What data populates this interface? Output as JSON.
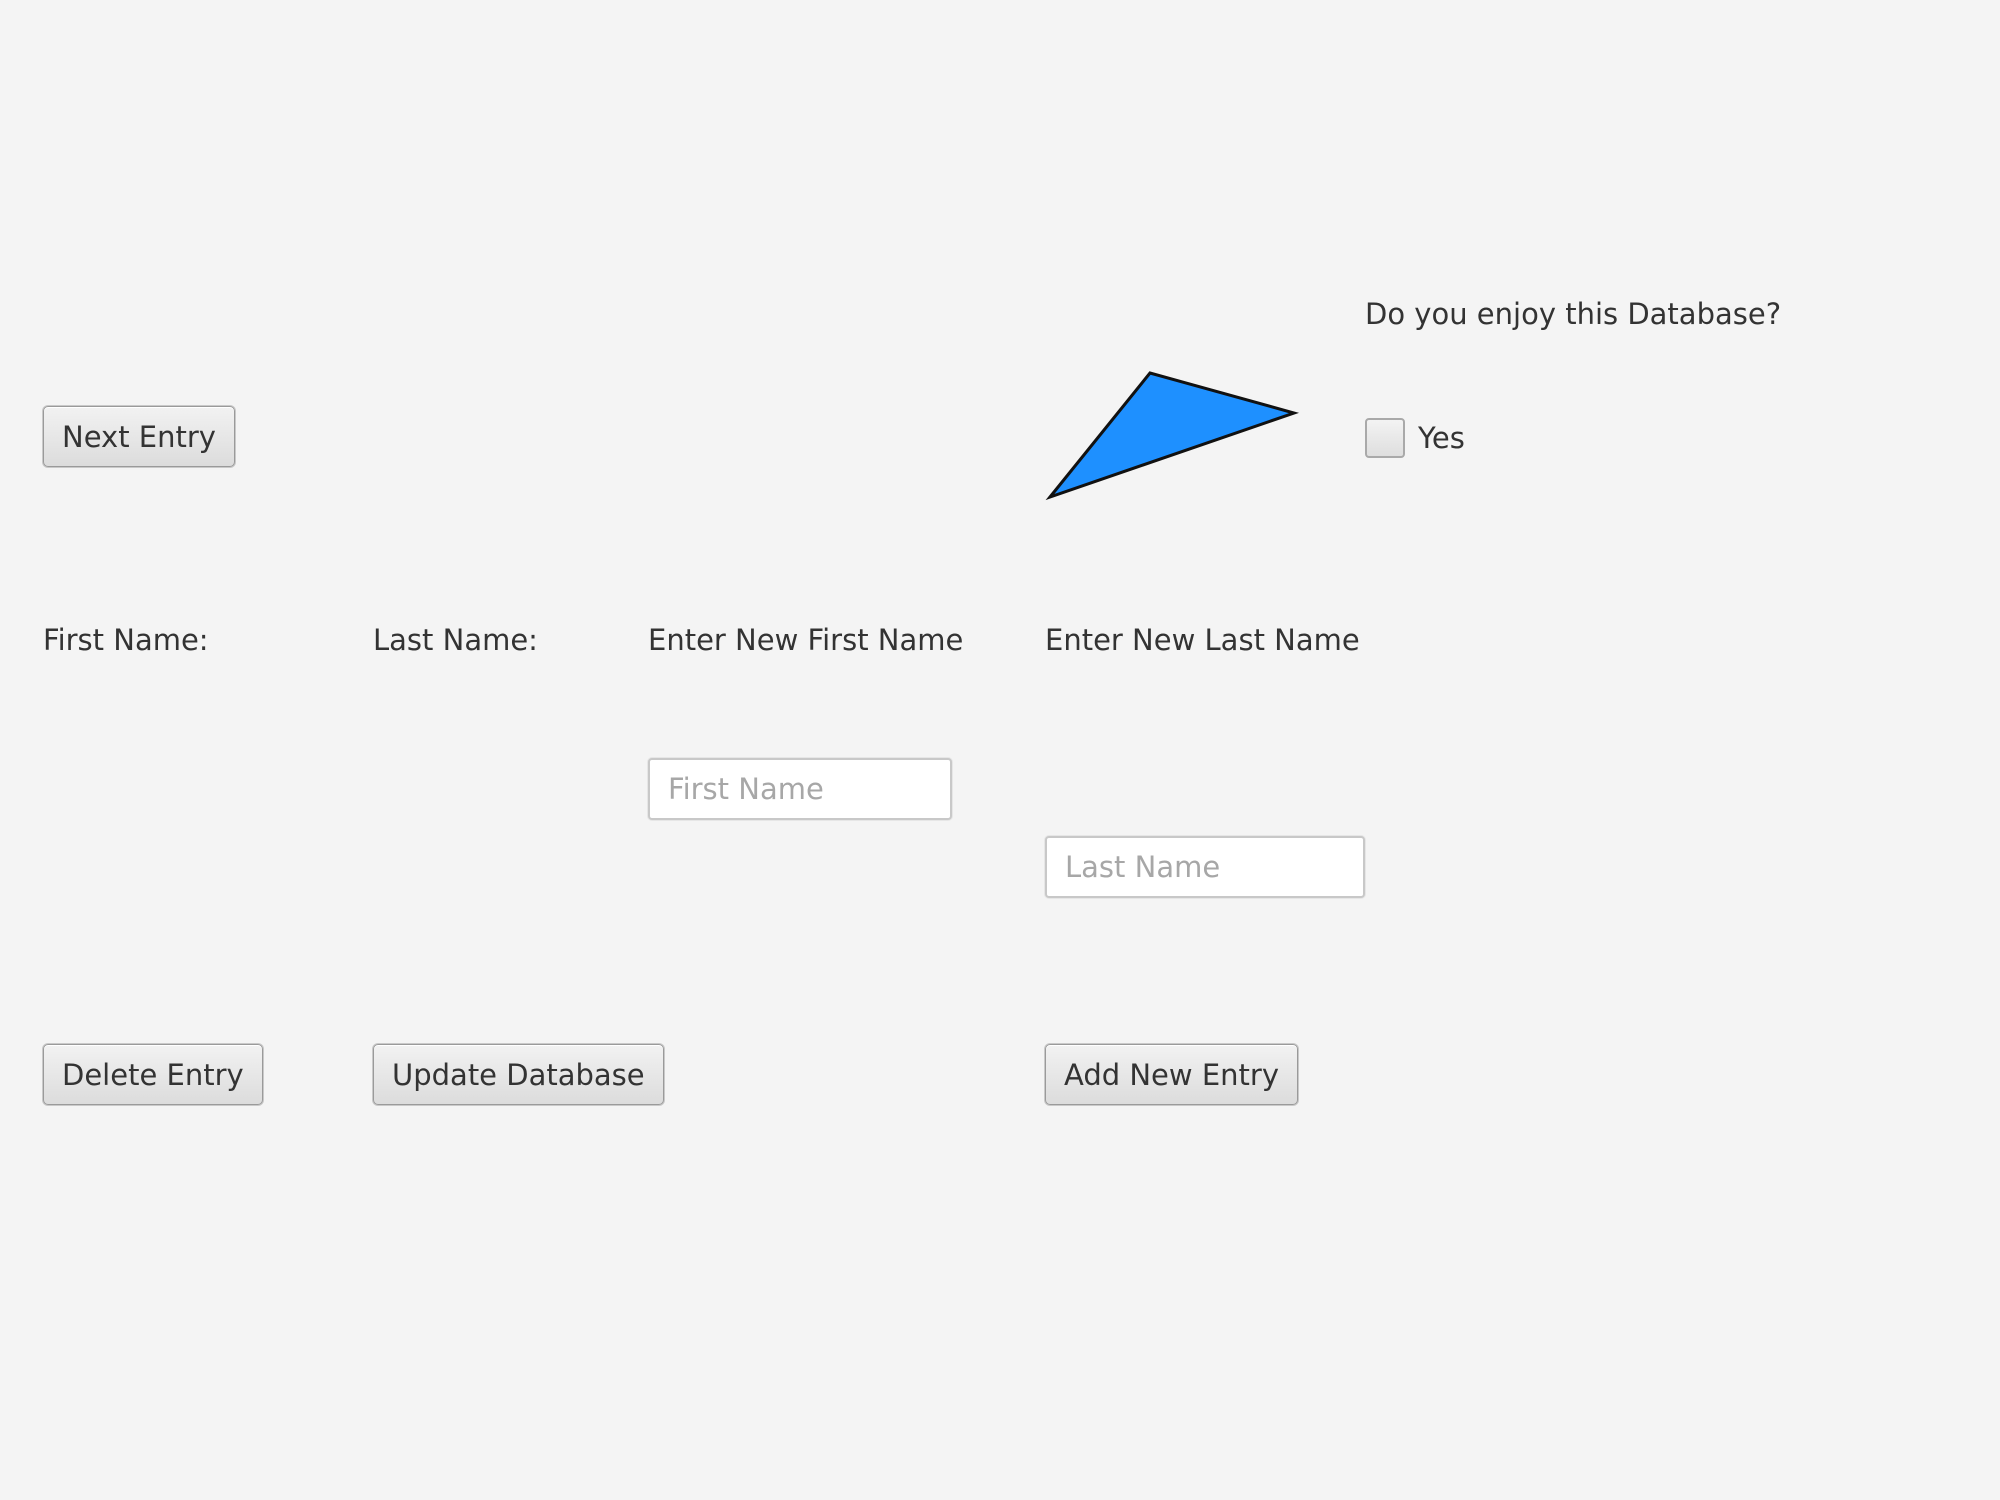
{
  "navigation": {
    "next_label": "Next Entry"
  },
  "survey": {
    "question": "Do you enjoy this Database?",
    "yes_label": "Yes",
    "yes_checked": false
  },
  "shape": {
    "fill": "#1e90ff",
    "stroke": "#111111"
  },
  "form": {
    "first_name_label": "First Name:",
    "last_name_label": "Last Name:",
    "new_first_label": "Enter New First Name",
    "new_last_label": "Enter New Last Name",
    "first_input": {
      "value": "",
      "placeholder": "First Name"
    },
    "last_input": {
      "value": "",
      "placeholder": "Last Name"
    }
  },
  "actions": {
    "delete_label": "Delete Entry",
    "update_label": "Update Database",
    "add_label": "Add New Entry"
  }
}
